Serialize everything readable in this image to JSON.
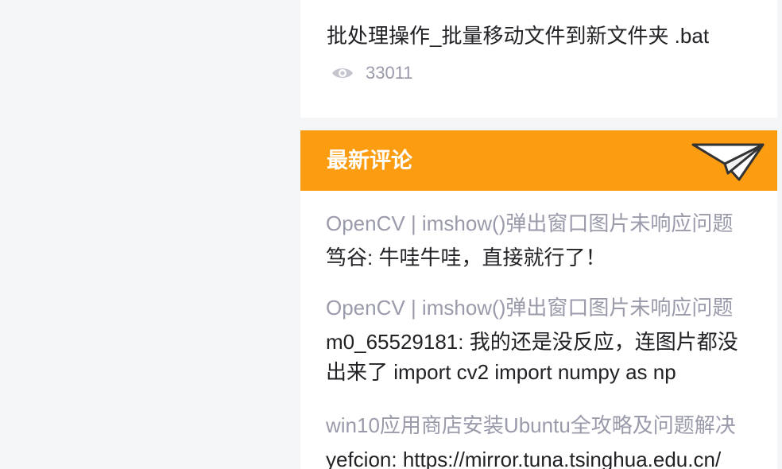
{
  "hot_article": {
    "title": "批处理操作_批量移动文件到新文件夹 .bat",
    "icon": "eye-icon",
    "views": "33011"
  },
  "comments_section": {
    "title": "最新评论",
    "icon": "paper-plane-icon",
    "header_color": "#fc9c10",
    "items": [
      {
        "article": "OpenCV | imshow()弹出窗口图片未响应问题",
        "text": "笃谷: 牛哇牛哇，直接就行了！"
      },
      {
        "article": "OpenCV | imshow()弹出窗口图片未响应问题",
        "text": "m0_65529181: 我的还是没反应，连图片都没出来了 import cv2 import numpy as np"
      },
      {
        "article": "win10应用商店安装Ubuntu全攻略及问题解决",
        "text": "yefcion: https://mirror.tuna.tsinghua.edu.cn/"
      }
    ]
  }
}
